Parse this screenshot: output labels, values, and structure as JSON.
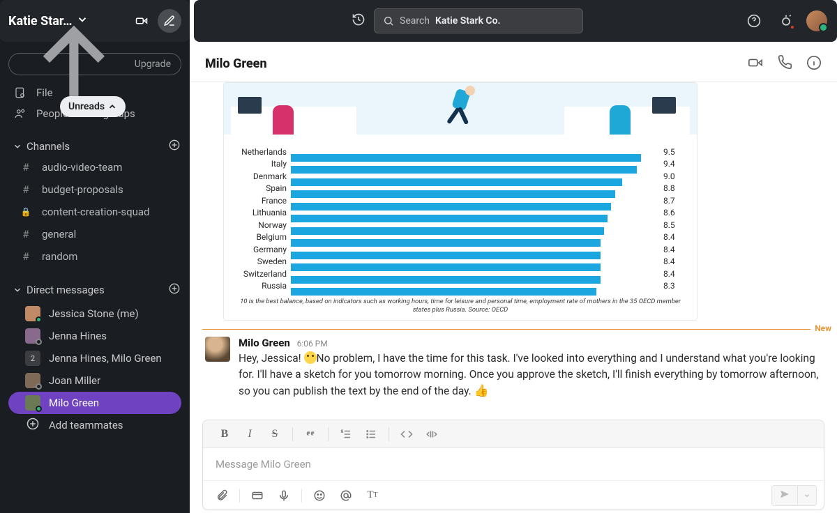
{
  "workspace": {
    "name": "Katie Star…"
  },
  "upgrade_label": "Upgrade",
  "floating": {
    "label": "Unreads"
  },
  "nav": {
    "file": "File",
    "people": "People & user groups"
  },
  "channels": {
    "header": "Channels",
    "items": [
      {
        "name": "audio-video-team",
        "locked": false
      },
      {
        "name": "budget-proposals",
        "locked": false
      },
      {
        "name": "content-creation-squad",
        "locked": true
      },
      {
        "name": "general",
        "locked": false
      },
      {
        "name": "random",
        "locked": false
      }
    ]
  },
  "dms": {
    "header": "Direct messages",
    "items": [
      {
        "name": "Jessica Stone (me)",
        "status": "online",
        "type": "single"
      },
      {
        "name": "Jenna Hines",
        "status": "offline",
        "type": "single"
      },
      {
        "name": "Jenna Hines, Milo Green",
        "status": "group",
        "count": "2"
      },
      {
        "name": "Joan Miller",
        "status": "offline",
        "type": "single"
      },
      {
        "name": "Milo Green",
        "status": "online",
        "type": "single",
        "active": true
      }
    ],
    "add_label": "Add teammates"
  },
  "search": {
    "prefix": "Search",
    "term": "Katie Stark Co."
  },
  "conversation": {
    "name": "Milo Green",
    "divider_label": "New",
    "message": {
      "author": "Milo Green",
      "time": "6:06 PM",
      "text_before_emoji": "Hey, Jessica! ",
      "text_after_emoji": "No problem, I have the time for this task. I've looked into everything and I understand what you're looking for. I'll have a sketch for you tomorrow morning. Once you approve the sketch, I'll finish everything by tomorrow afternoon, so you can publish the text by the end of the day. ",
      "thumb": "👍"
    },
    "composer_placeholder": "Message Milo Green"
  },
  "chart_data": {
    "type": "bar",
    "orientation": "horizontal",
    "categories": [
      "Netherlands",
      "Italy",
      "Denmark",
      "Spain",
      "France",
      "Lithuania",
      "Norway",
      "Belgium",
      "Germany",
      "Sweden",
      "Switzerland",
      "Russia"
    ],
    "values": [
      9.5,
      9.4,
      9.0,
      8.8,
      8.7,
      8.6,
      8.5,
      8.4,
      8.4,
      8.4,
      8.4,
      8.3
    ],
    "xlim": [
      0,
      10
    ],
    "bar_color": "#1ca6df",
    "footnote": "10 is the best balance, based on indicators such as working hours, time for leisure and personal time, employment rate of mothers in the 35 OECD member states plus Russia. Source: OECD"
  }
}
